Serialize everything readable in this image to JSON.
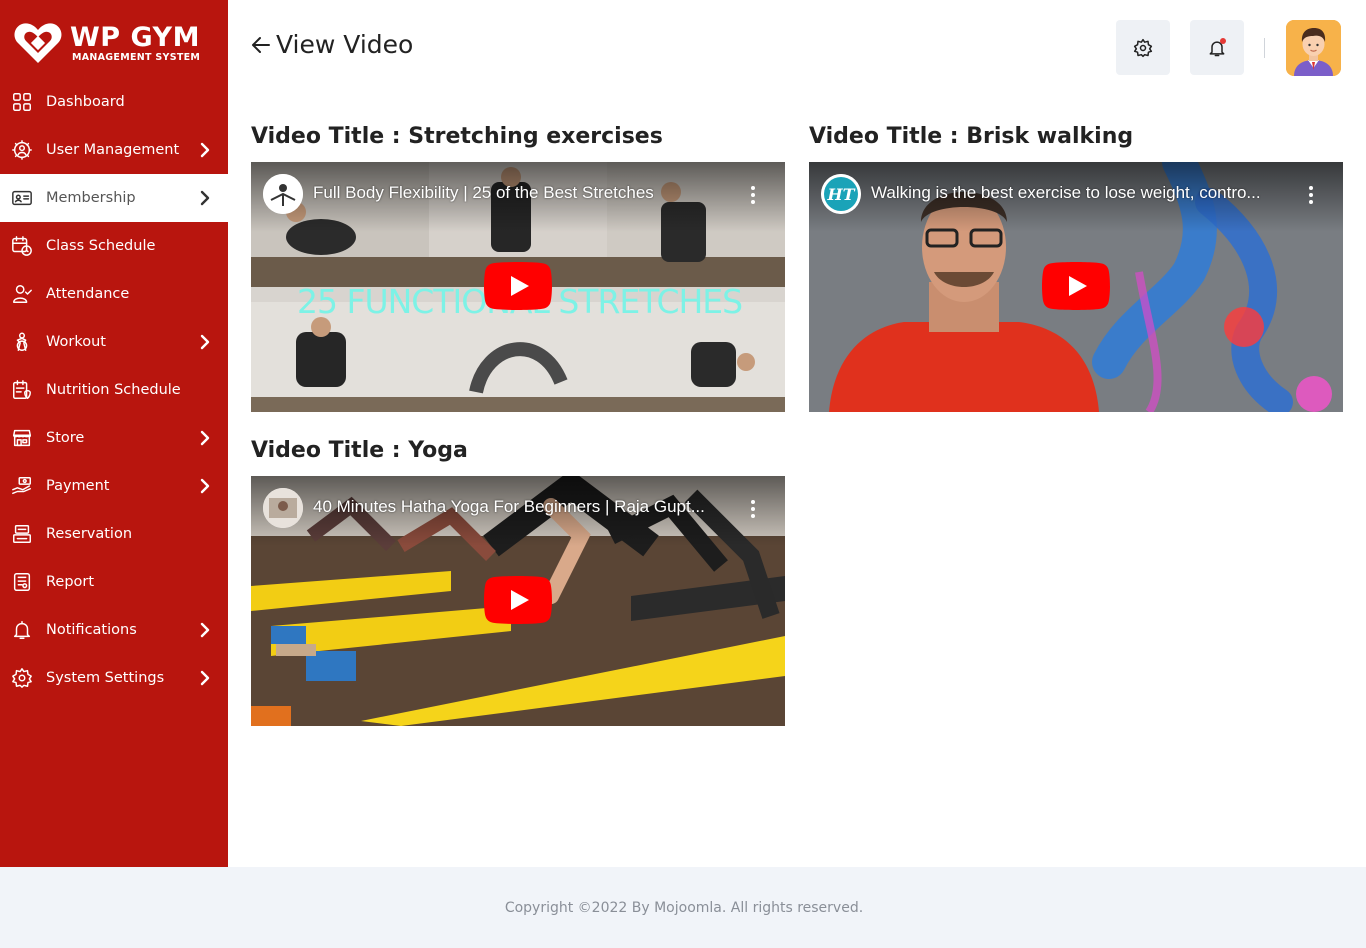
{
  "brand": {
    "name": "WP GYM",
    "subtitle": "MANAGEMENT SYSTEM",
    "color": "#b8150e"
  },
  "sidebar": {
    "items": [
      {
        "label": "Dashboard",
        "icon": "dashboard-icon",
        "has_submenu": false,
        "active": false
      },
      {
        "label": "User Management",
        "icon": "users-gear-icon",
        "has_submenu": true,
        "active": false
      },
      {
        "label": "Membership",
        "icon": "membership-card-icon",
        "has_submenu": true,
        "active": true
      },
      {
        "label": "Class Schedule",
        "icon": "calendar-clock-icon",
        "has_submenu": false,
        "active": false
      },
      {
        "label": "Attendance",
        "icon": "user-check-icon",
        "has_submenu": false,
        "active": false
      },
      {
        "label": "Workout",
        "icon": "workout-icon",
        "has_submenu": true,
        "active": false
      },
      {
        "label": "Nutrition Schedule",
        "icon": "nutrition-icon",
        "has_submenu": false,
        "active": false
      },
      {
        "label": "Store",
        "icon": "store-icon",
        "has_submenu": true,
        "active": false
      },
      {
        "label": "Payment",
        "icon": "payment-icon",
        "has_submenu": true,
        "active": false
      },
      {
        "label": "Reservation",
        "icon": "reservation-icon",
        "has_submenu": false,
        "active": false
      },
      {
        "label": "Report",
        "icon": "report-icon",
        "has_submenu": false,
        "active": false
      },
      {
        "label": "Notifications",
        "icon": "bell-icon",
        "has_submenu": true,
        "active": false
      },
      {
        "label": "System Settings",
        "icon": "gear-icon",
        "has_submenu": true,
        "active": false
      }
    ]
  },
  "header": {
    "title": "View Video"
  },
  "videos": [
    {
      "title": "Video Title : Stretching exercises",
      "video_name": "Full Body Flexibility | 25 of the Best Stretches",
      "overlay": "25 FUNCTIONAL STRETCHES"
    },
    {
      "title": "Video Title : Brisk walking",
      "video_name": "Walking is the best exercise to lose weight, contro...",
      "overlay": ""
    },
    {
      "title": "Video Title : Yoga",
      "video_name": "40 Minutes Hatha Yoga For Beginners | Raja Gupt...",
      "overlay": ""
    }
  ],
  "footer": {
    "copyright": "Copyright ©2022 By Mojoomla. All rights reserved."
  }
}
